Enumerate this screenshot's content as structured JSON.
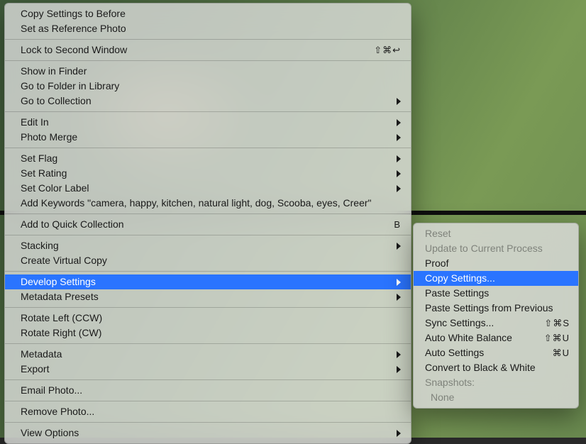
{
  "menu": {
    "copy_before": "Copy Settings to Before",
    "set_reference": "Set as Reference Photo",
    "lock_second": "Lock to Second Window",
    "lock_second_shortcut": "⇧⌘↩",
    "show_finder": "Show in Finder",
    "go_folder": "Go to Folder in Library",
    "go_collection": "Go to Collection",
    "edit_in": "Edit In",
    "photo_merge": "Photo Merge",
    "set_flag": "Set Flag",
    "set_rating": "Set Rating",
    "set_color_label": "Set Color Label",
    "add_keywords": "Add Keywords \"camera, happy, kitchen, natural light, dog, Scooba, eyes, Creer\"",
    "add_quick": "Add to Quick Collection",
    "add_quick_shortcut": "B",
    "stacking": "Stacking",
    "create_virtual": "Create Virtual Copy",
    "develop_settings": "Develop Settings",
    "metadata_presets": "Metadata Presets",
    "rotate_left": "Rotate Left (CCW)",
    "rotate_right": "Rotate Right (CW)",
    "metadata": "Metadata",
    "export": "Export",
    "email_photo": "Email Photo...",
    "remove_photo": "Remove Photo...",
    "view_options": "View Options"
  },
  "submenu": {
    "reset": "Reset",
    "update_process": "Update to Current Process",
    "proof": "Proof",
    "copy_settings": "Copy Settings...",
    "paste_settings": "Paste Settings",
    "paste_previous": "Paste Settings from Previous",
    "sync_settings": "Sync Settings...",
    "sync_shortcut": "⇧⌘S",
    "auto_wb": "Auto White Balance",
    "auto_wb_shortcut": "⇧⌘U",
    "auto_settings": "Auto Settings",
    "auto_settings_shortcut": "⌘U",
    "convert_bw": "Convert to Black & White",
    "snapshots": "Snapshots:",
    "none": "None"
  }
}
